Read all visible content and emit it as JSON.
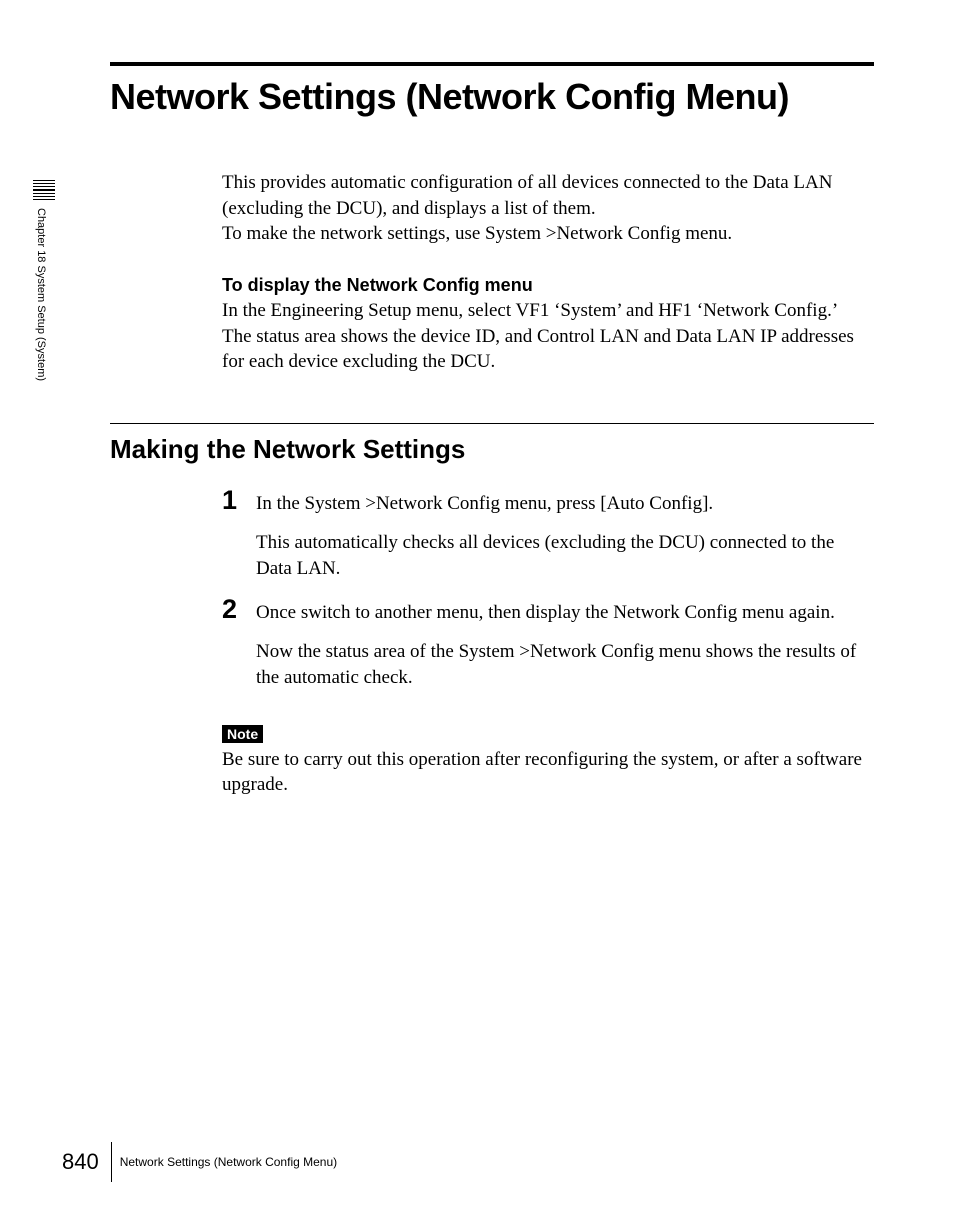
{
  "main_title": "Network Settings (Network Config Menu)",
  "intro": {
    "para1": "This provides automatic configuration of all devices connected to the Data LAN (excluding the DCU), and displays a list of them.",
    "para2": "To make the network settings, use System >Network Config menu."
  },
  "display_section": {
    "heading": "To display the Network Config menu",
    "para1": "In the Engineering Setup menu, select VF1 ‘System’ and HF1 ‘Network Config.’",
    "para2": "The status area shows the device ID, and Control LAN and Data LAN IP addresses for each device excluding the DCU."
  },
  "section": {
    "title": "Making the Network Settings",
    "steps": [
      {
        "num": "1",
        "text": "In the System >Network Config menu, press [Auto Config].",
        "sub": "This automatically checks all devices (excluding the DCU) connected to the Data LAN."
      },
      {
        "num": "2",
        "text": "Once switch to another menu, then display the Network Config menu again.",
        "sub": "Now the status area of the System >Network Config menu shows the results of the automatic check."
      }
    ]
  },
  "note": {
    "label": "Note",
    "text": "Be sure to carry out this operation after reconfiguring the system, or after a software upgrade."
  },
  "sidebar": {
    "text": "Chapter 18  System Setup (System)"
  },
  "footer": {
    "page_number": "840",
    "text": "Network Settings (Network Config Menu)"
  }
}
